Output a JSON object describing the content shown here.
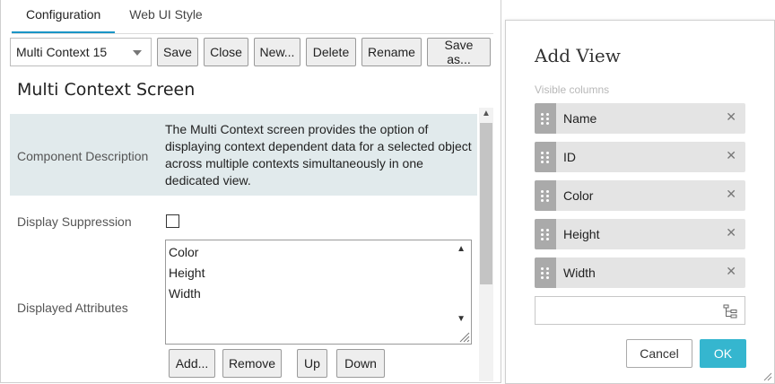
{
  "tabs": [
    {
      "label": "Configuration",
      "active": true
    },
    {
      "label": "Web UI Style",
      "active": false
    }
  ],
  "toolbar": {
    "selected_config": "Multi Context 15",
    "save_label": "Save",
    "close_label": "Close",
    "new_label": "New...",
    "delete_label": "Delete",
    "rename_label": "Rename",
    "save_as_label": "Save as..."
  },
  "screen": {
    "title": "Multi Context Screen",
    "component_description_label": "Component Description",
    "component_description_text": "The Multi Context screen provides the option of displaying context dependent data for a selected object across multiple contexts simultaneously in one dedicated view.",
    "display_suppression_label": "Display Suppression",
    "display_suppression_checked": false,
    "displayed_attributes_label": "Displayed Attributes",
    "displayed_attributes": [
      "Color",
      "Height",
      "Width"
    ],
    "attr_buttons": {
      "add": "Add...",
      "remove": "Remove",
      "up": "Up",
      "down": "Down"
    }
  },
  "dialog": {
    "title": "Add View",
    "section_label": "Visible columns",
    "columns": [
      "Name",
      "ID",
      "Color",
      "Height",
      "Width"
    ],
    "add_input_value": "",
    "cancel_label": "Cancel",
    "ok_label": "OK"
  },
  "colors": {
    "accent": "#1a95c6",
    "ok_button": "#35b6cf",
    "description_bg": "#e1eaec"
  },
  "icons": {
    "dropdown": "chevron-down-icon",
    "remove_column": "close-icon",
    "drag": "drag-handle-icon",
    "tree": "tree-picker-icon"
  }
}
